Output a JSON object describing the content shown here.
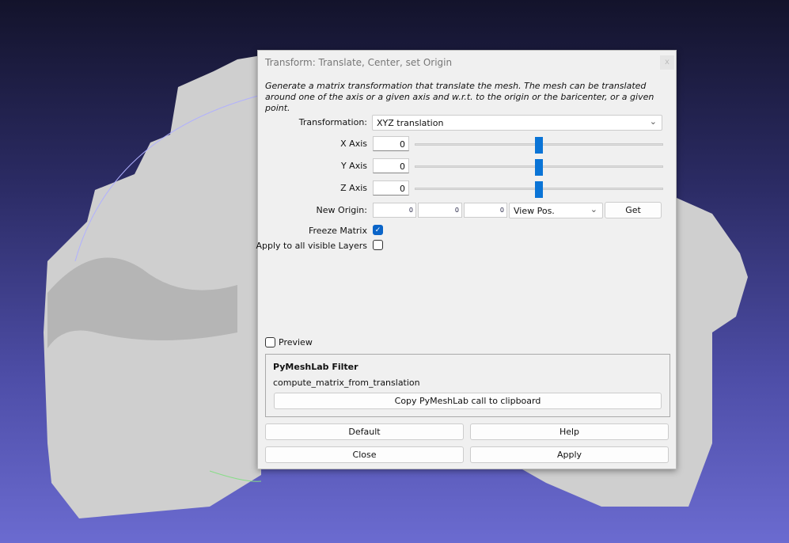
{
  "dialog": {
    "title": "Transform: Translate, Center, set Origin",
    "close_label": "x",
    "description": "Generate a matrix transformation that translate the mesh. The mesh can be translated around one of the axis or a given axis and w.r.t. to the origin or the baricenter, or a given point.",
    "transformation": {
      "label": "Transformation:",
      "value": "XYZ translation"
    },
    "axes": [
      {
        "label": "X Axis",
        "value": "0",
        "slider_fraction": 0.5
      },
      {
        "label": "Y Axis",
        "value": "0",
        "slider_fraction": 0.5
      },
      {
        "label": "Z Axis",
        "value": "0",
        "slider_fraction": 0.5
      }
    ],
    "new_origin": {
      "label": "New Origin:",
      "x": "0",
      "y": "0",
      "z": "0",
      "mode": "View Pos.",
      "get_label": "Get"
    },
    "freeze_matrix": {
      "label": "Freeze Matrix",
      "checked": true
    },
    "apply_all": {
      "label": "Apply to all visible Layers",
      "checked": false
    },
    "preview": {
      "label": "Preview",
      "checked": false
    },
    "pymeshlab": {
      "title": "PyMeshLab Filter",
      "function": "compute_matrix_from_translation",
      "copy_label": "Copy PyMeshLab call to clipboard"
    },
    "buttons": {
      "default": "Default",
      "help": "Help",
      "close": "Close",
      "apply": "Apply"
    },
    "accent": "#0a74d6"
  }
}
